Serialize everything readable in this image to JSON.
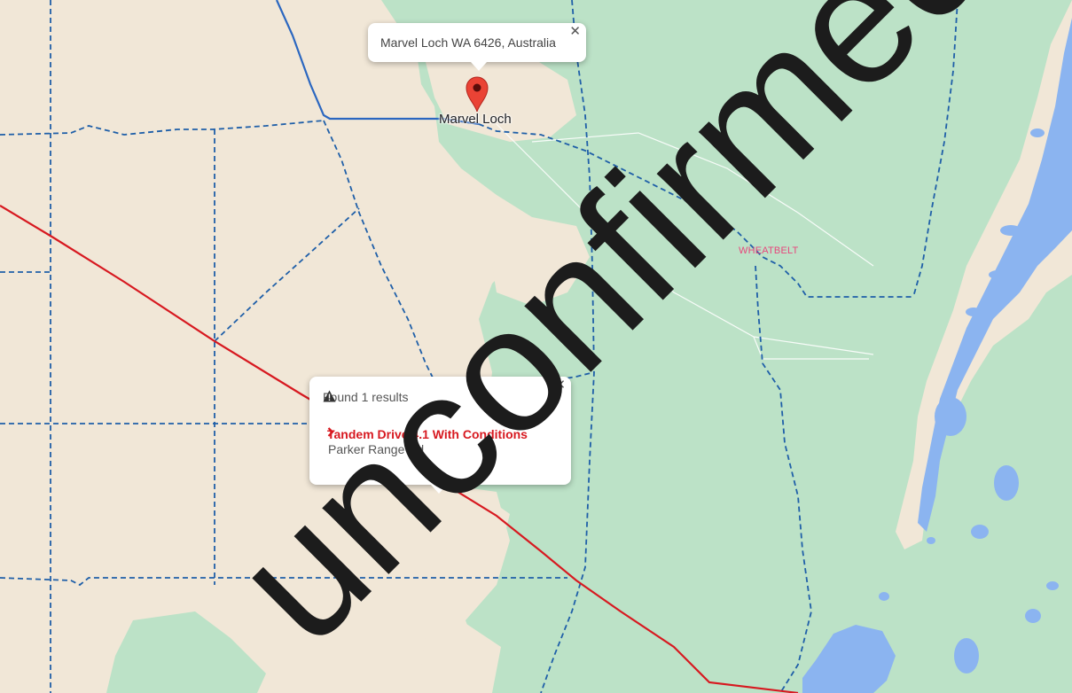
{
  "colors": {
    "land": "#f1e7d7",
    "vegetation": "#bce2c7",
    "water": "#8bb4f0",
    "boundary_dashed": "#1f5fa8",
    "route": "#d71920",
    "highway": "#2b67c0",
    "region_label": "#e8467c"
  },
  "place_popup": {
    "address": "Marvel Loch WA 6426, Australia",
    "close_icon": "close-icon"
  },
  "marker": {
    "icon": "map-pin-icon",
    "color": "#ea4335"
  },
  "labels": {
    "town": "Marvel Loch",
    "region": "WHEATBELT"
  },
  "results_popup": {
    "header": "Found 1 results",
    "header_icon": "warning-icon",
    "result_icon": "chevron-right-icon",
    "result_title": "Tandem Drive 4.1 With Conditions",
    "result_road": "Parker Range Rd",
    "close_icon": "close-icon"
  },
  "watermark": "unconfirmed"
}
